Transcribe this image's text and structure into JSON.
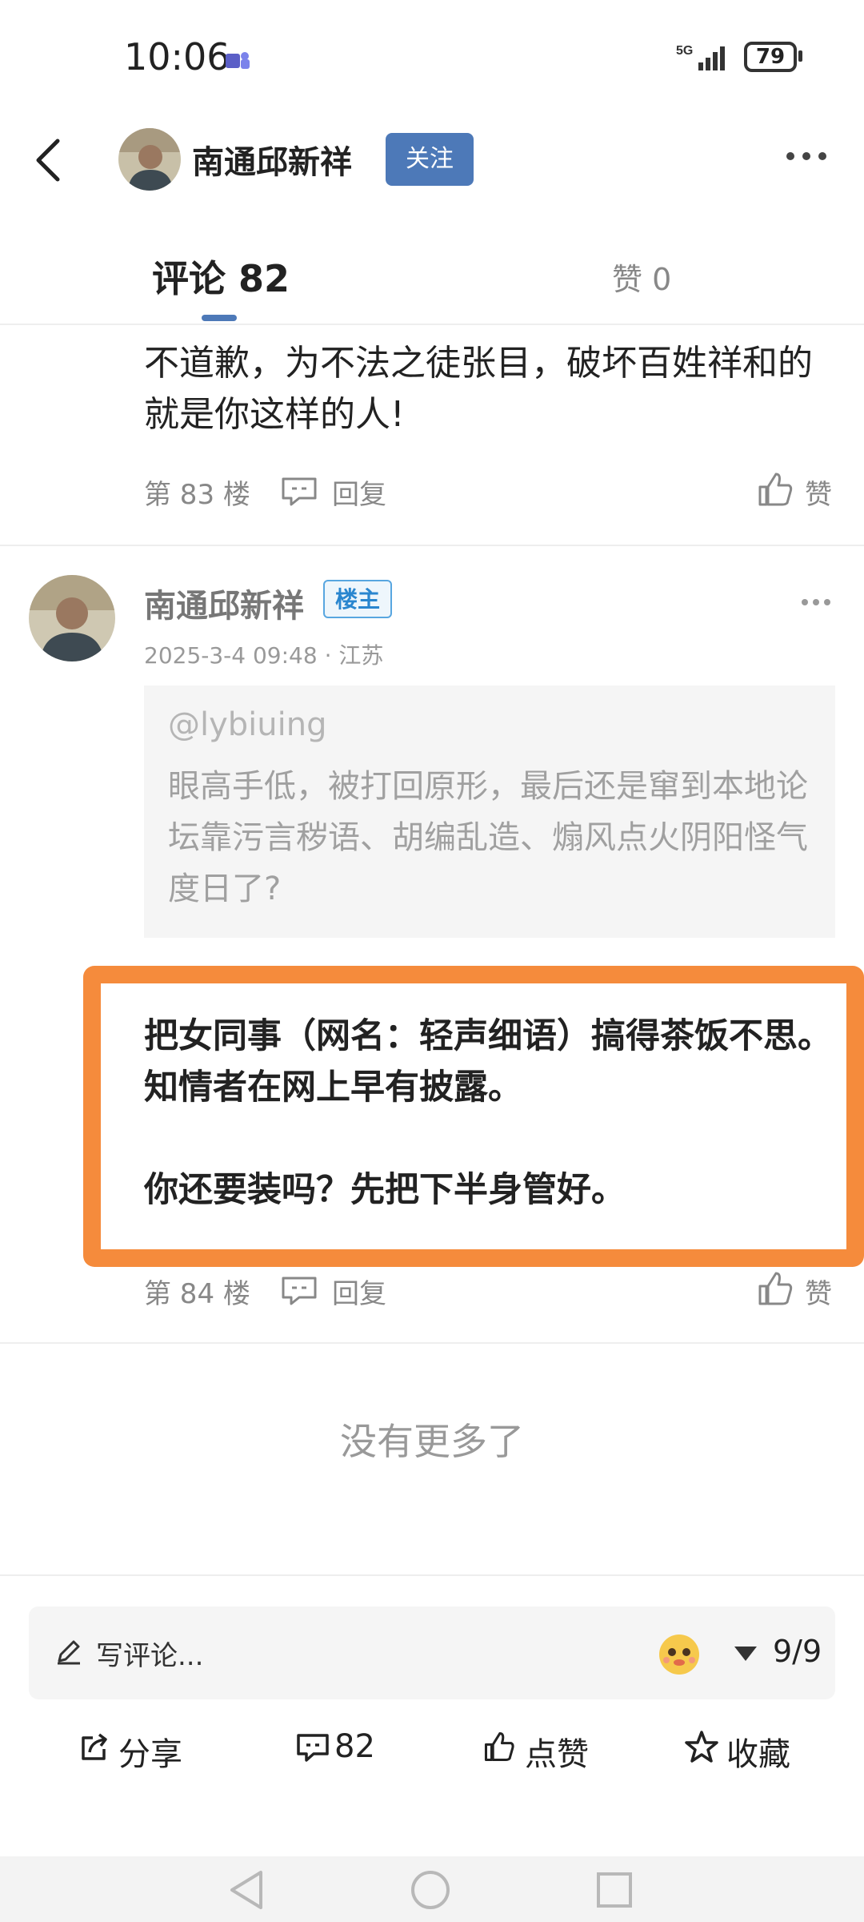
{
  "status_bar": {
    "time": "10:06",
    "network": "5G",
    "battery": "79"
  },
  "header": {
    "name": "南通邱新祥",
    "follow_label": "关注"
  },
  "tabs": {
    "comments": "评论 82",
    "likes": "赞 0"
  },
  "comments": [
    {
      "text": "不道歉，为不法之徒张目，破坏百姓祥和的就是你这样的人!",
      "floor": "第 83 楼",
      "reply_label": "回复",
      "like_label": "赞"
    },
    {
      "author": "南通邱新祥",
      "badge": "楼主",
      "time_location": "2025-3-4 09:48 · 江苏",
      "quote_user": "@lybiuing",
      "quote_text": "眼高手低，被打回原形，最后还是窜到本地论坛靠污言秽语、胡编乱造、煽风点火阴阳怪气度日了?",
      "reply_line1": "把女同事（网名：轻声细语）搞得茶饭不思。知情者在网上早有披露。",
      "reply_line2": "你还要装吗？先把下半身管好。",
      "floor": "第 84 楼",
      "reply_label": "回复",
      "like_label": "赞"
    }
  ],
  "no_more": "没有更多了",
  "composer": {
    "placeholder": "写评论...",
    "page": "9/9"
  },
  "actions": {
    "share": "分享",
    "comments": "82",
    "like": "点赞",
    "favorite": "收藏"
  },
  "colors": {
    "accent": "#4d79b8",
    "highlight": "#f58b3c",
    "badge": "#2a86cf"
  }
}
